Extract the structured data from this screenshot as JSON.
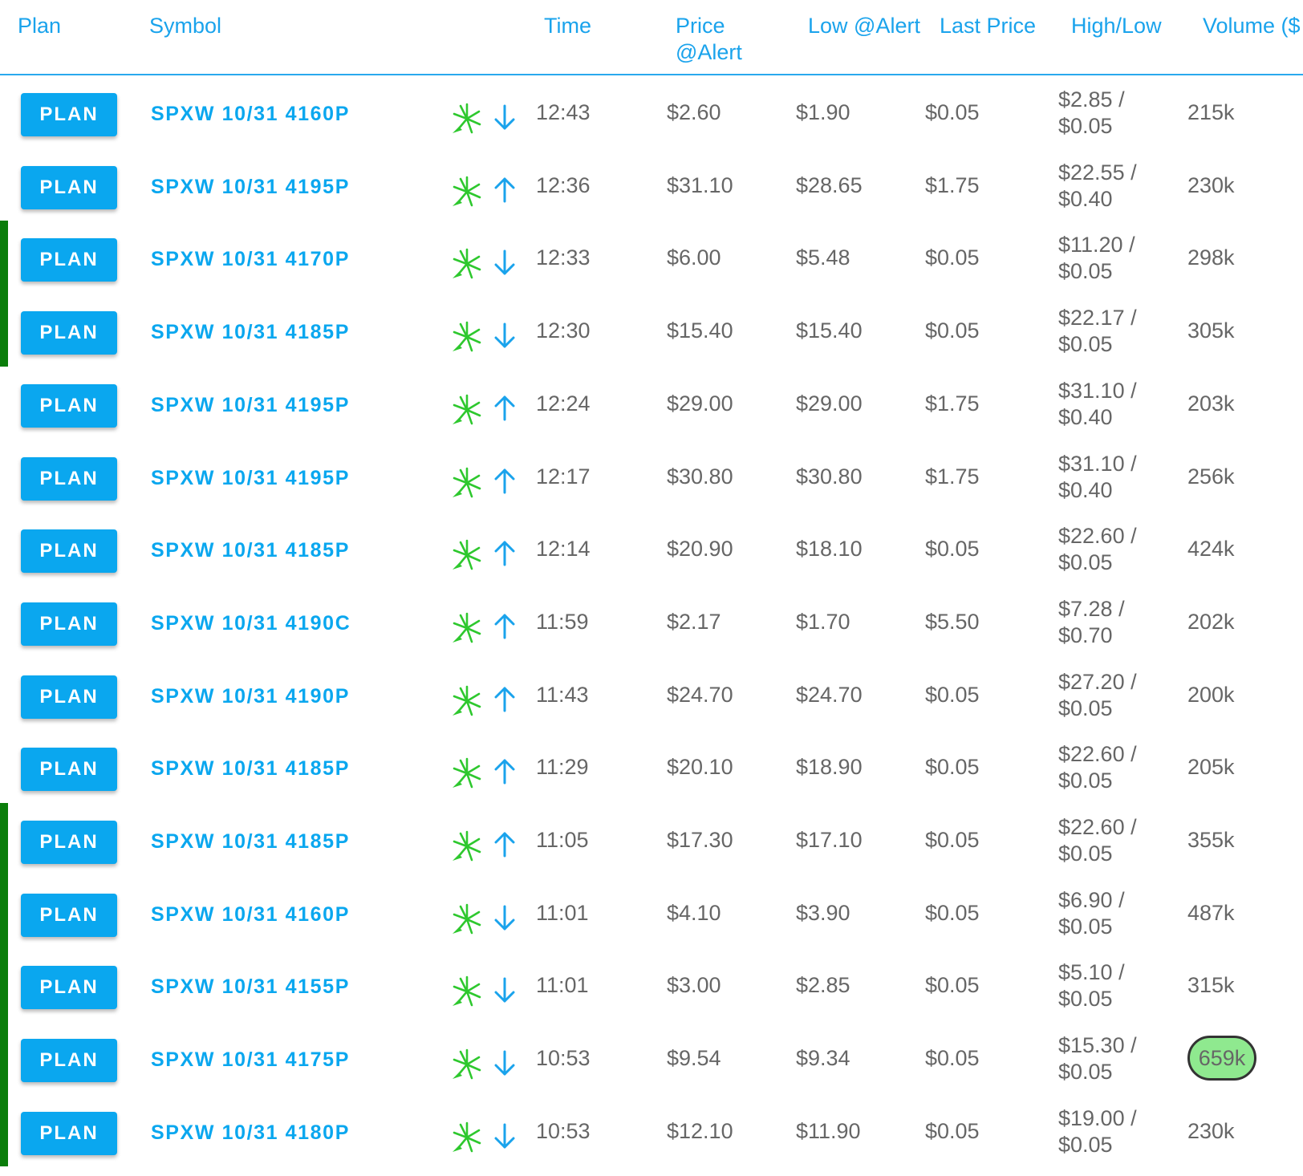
{
  "header": {
    "plan": "Plan",
    "symbol": "Symbol",
    "time": "Time",
    "price_alert": "Price\n@Alert",
    "low_alert": "Low @Alert",
    "last_price": "Last Price",
    "high_low": "High/Low",
    "volume": "Volume ($"
  },
  "plan_label": "PLAN",
  "colors": {
    "accent": "#0aa7ef",
    "marker": "#0a7d0a",
    "spark": "#2ec82e",
    "badge": "#8fe98f"
  },
  "rows": [
    {
      "symbol": "SPXW 10/31 4160P",
      "direction": "down",
      "time": "12:43",
      "price": "$2.60",
      "low": "$1.90",
      "last": "$0.05",
      "highlow": "$2.85 /\n$0.05",
      "volume": "215k",
      "marker": false,
      "highlight": false
    },
    {
      "symbol": "SPXW 10/31 4195P",
      "direction": "up",
      "time": "12:36",
      "price": "$31.10",
      "low": "$28.65",
      "last": "$1.75",
      "highlow": "$22.55 /\n$0.40",
      "volume": "230k",
      "marker": false,
      "highlight": false
    },
    {
      "symbol": "SPXW 10/31 4170P",
      "direction": "down",
      "time": "12:33",
      "price": "$6.00",
      "low": "$5.48",
      "last": "$0.05",
      "highlow": "$11.20 /\n$0.05",
      "volume": "298k",
      "marker": true,
      "highlight": false
    },
    {
      "symbol": "SPXW 10/31 4185P",
      "direction": "down",
      "time": "12:30",
      "price": "$15.40",
      "low": "$15.40",
      "last": "$0.05",
      "highlow": "$22.17 /\n$0.05",
      "volume": "305k",
      "marker": true,
      "highlight": false
    },
    {
      "symbol": "SPXW 10/31 4195P",
      "direction": "up",
      "time": "12:24",
      "price": "$29.00",
      "low": "$29.00",
      "last": "$1.75",
      "highlow": "$31.10 /\n$0.40",
      "volume": "203k",
      "marker": false,
      "highlight": false
    },
    {
      "symbol": "SPXW 10/31 4195P",
      "direction": "up",
      "time": "12:17",
      "price": "$30.80",
      "low": "$30.80",
      "last": "$1.75",
      "highlow": "$31.10 /\n$0.40",
      "volume": "256k",
      "marker": false,
      "highlight": false
    },
    {
      "symbol": "SPXW 10/31 4185P",
      "direction": "up",
      "time": "12:14",
      "price": "$20.90",
      "low": "$18.10",
      "last": "$0.05",
      "highlow": "$22.60 /\n$0.05",
      "volume": "424k",
      "marker": false,
      "highlight": false
    },
    {
      "symbol": "SPXW 10/31 4190C",
      "direction": "up",
      "time": "11:59",
      "price": "$2.17",
      "low": "$1.70",
      "last": "$5.50",
      "highlow": "$7.28 /\n$0.70",
      "volume": "202k",
      "marker": false,
      "highlight": false
    },
    {
      "symbol": "SPXW 10/31 4190P",
      "direction": "up",
      "time": "11:43",
      "price": "$24.70",
      "low": "$24.70",
      "last": "$0.05",
      "highlow": "$27.20 /\n$0.05",
      "volume": "200k",
      "marker": false,
      "highlight": false
    },
    {
      "symbol": "SPXW 10/31 4185P",
      "direction": "up",
      "time": "11:29",
      "price": "$20.10",
      "low": "$18.90",
      "last": "$0.05",
      "highlow": "$22.60 /\n$0.05",
      "volume": "205k",
      "marker": false,
      "highlight": false
    },
    {
      "symbol": "SPXW 10/31 4185P",
      "direction": "up",
      "time": "11:05",
      "price": "$17.30",
      "low": "$17.10",
      "last": "$0.05",
      "highlow": "$22.60 /\n$0.05",
      "volume": "355k",
      "marker": true,
      "highlight": false
    },
    {
      "symbol": "SPXW 10/31 4160P",
      "direction": "down",
      "time": "11:01",
      "price": "$4.10",
      "low": "$3.90",
      "last": "$0.05",
      "highlow": "$6.90 /\n$0.05",
      "volume": "487k",
      "marker": true,
      "highlight": false
    },
    {
      "symbol": "SPXW 10/31 4155P",
      "direction": "down",
      "time": "11:01",
      "price": "$3.00",
      "low": "$2.85",
      "last": "$0.05",
      "highlow": "$5.10 /\n$0.05",
      "volume": "315k",
      "marker": true,
      "highlight": false
    },
    {
      "symbol": "SPXW 10/31 4175P",
      "direction": "down",
      "time": "10:53",
      "price": "$9.54",
      "low": "$9.34",
      "last": "$0.05",
      "highlow": "$15.30 /\n$0.05",
      "volume": "659k",
      "marker": true,
      "highlight": true
    },
    {
      "symbol": "SPXW 10/31 4180P",
      "direction": "down",
      "time": "10:53",
      "price": "$12.10",
      "low": "$11.90",
      "last": "$0.05",
      "highlow": "$19.00 /\n$0.05",
      "volume": "230k",
      "marker": true,
      "highlight": false
    }
  ]
}
